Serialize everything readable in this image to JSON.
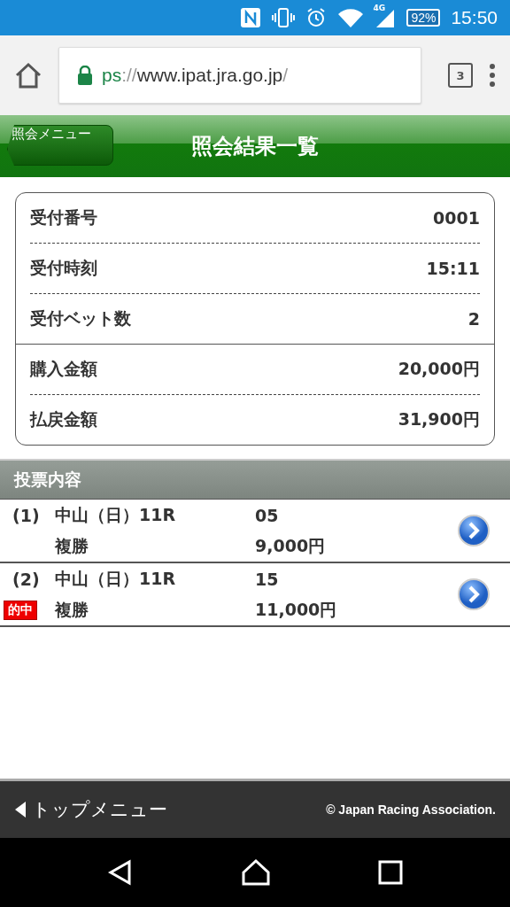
{
  "status_bar": {
    "network": "4G",
    "battery": "92%",
    "time": "15:50"
  },
  "browser": {
    "url_scheme": "ps",
    "url_separator": "://",
    "url_host": "www.ipat.jra.go.jp",
    "url_rest": "/",
    "tab_count": "3"
  },
  "header": {
    "back_label": "照会メニュー",
    "title": "照会結果一覧"
  },
  "summary": {
    "info": [
      {
        "label": "受付番号",
        "value": "0001"
      },
      {
        "label": "受付時刻",
        "value": "15:11"
      },
      {
        "label": "受付ベット数",
        "value": "2"
      }
    ],
    "amounts": [
      {
        "label": "購入金額",
        "value": "20,000円"
      },
      {
        "label": "払戻金額",
        "value": "31,900円"
      }
    ]
  },
  "bets_section": {
    "title": "投票内容",
    "bets": [
      {
        "index": "(1)",
        "venue": "中山（日）11R",
        "bet_type": "複勝",
        "horse": "05",
        "amount": "9,000円",
        "hit": false
      },
      {
        "index": "(2)",
        "venue": "中山（日）11R",
        "bet_type": "複勝",
        "horse": "15",
        "amount": "11,000円",
        "hit": true,
        "hit_label": "的中"
      }
    ]
  },
  "footer": {
    "menu_label": "トップメニュー",
    "copyright": "© Japan Racing Association."
  }
}
